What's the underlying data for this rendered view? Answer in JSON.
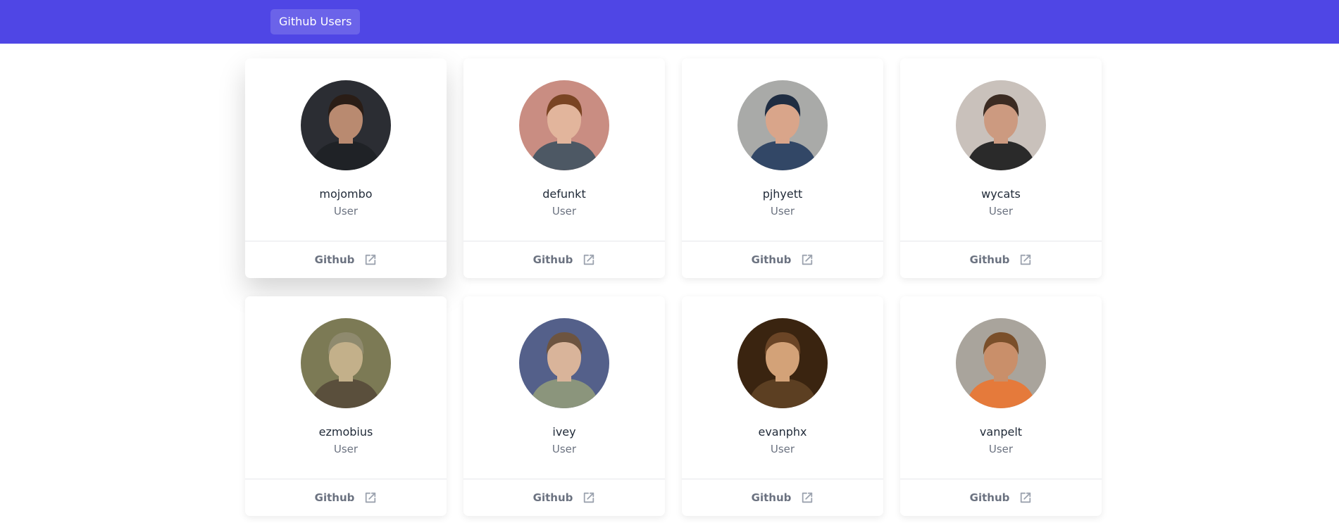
{
  "header": {
    "brand_label": "Github Users"
  },
  "users": [
    {
      "login": "mojombo",
      "role": "User",
      "link_label": "Github",
      "focused": true,
      "avatar": {
        "bg": "#2b2d33",
        "skin": "#b98a70",
        "hair": "#2a1d16",
        "shirt": "#1f2226"
      }
    },
    {
      "login": "defunkt",
      "role": "User",
      "link_label": "Github",
      "focused": false,
      "avatar": {
        "bg": "#c98d82",
        "skin": "#e2b59c",
        "hair": "#7a4423",
        "shirt": "#4d5864"
      }
    },
    {
      "login": "pjhyett",
      "role": "User",
      "link_label": "Github",
      "focused": false,
      "avatar": {
        "bg": "#a9aaa8",
        "skin": "#d9a58a",
        "hair": "#1f2d42",
        "shirt": "#324766"
      }
    },
    {
      "login": "wycats",
      "role": "User",
      "link_label": "Github",
      "focused": false,
      "avatar": {
        "bg": "#c9c1bb",
        "skin": "#cc9a80",
        "hair": "#3b2b22",
        "shirt": "#2a2a2a"
      }
    },
    {
      "login": "ezmobius",
      "role": "User",
      "link_label": "Github",
      "focused": false,
      "avatar": {
        "bg": "#7c7a55",
        "skin": "#c3b08a",
        "hair": "#8f8a6e",
        "shirt": "#5a4f3c"
      }
    },
    {
      "login": "ivey",
      "role": "User",
      "link_label": "Github",
      "focused": false,
      "avatar": {
        "bg": "#54608a",
        "skin": "#d9b49a",
        "hair": "#6d5440",
        "shirt": "#8b957c"
      }
    },
    {
      "login": "evanphx",
      "role": "User",
      "link_label": "Github",
      "focused": false,
      "avatar": {
        "bg": "#3a2410",
        "skin": "#d3a278",
        "hair": "#6b4526",
        "shirt": "#5c3f22"
      }
    },
    {
      "login": "vanpelt",
      "role": "User",
      "link_label": "Github",
      "focused": false,
      "avatar": {
        "bg": "#a9a49c",
        "skin": "#c98f6a",
        "hair": "#7a4f2a",
        "shirt": "#e57a3b"
      }
    }
  ],
  "colors": {
    "nav_bg": "#4f46e5",
    "muted_text": "#6b7280",
    "name_text": "#1f2937"
  },
  "icons": {
    "link_icon": "external-link-icon"
  }
}
